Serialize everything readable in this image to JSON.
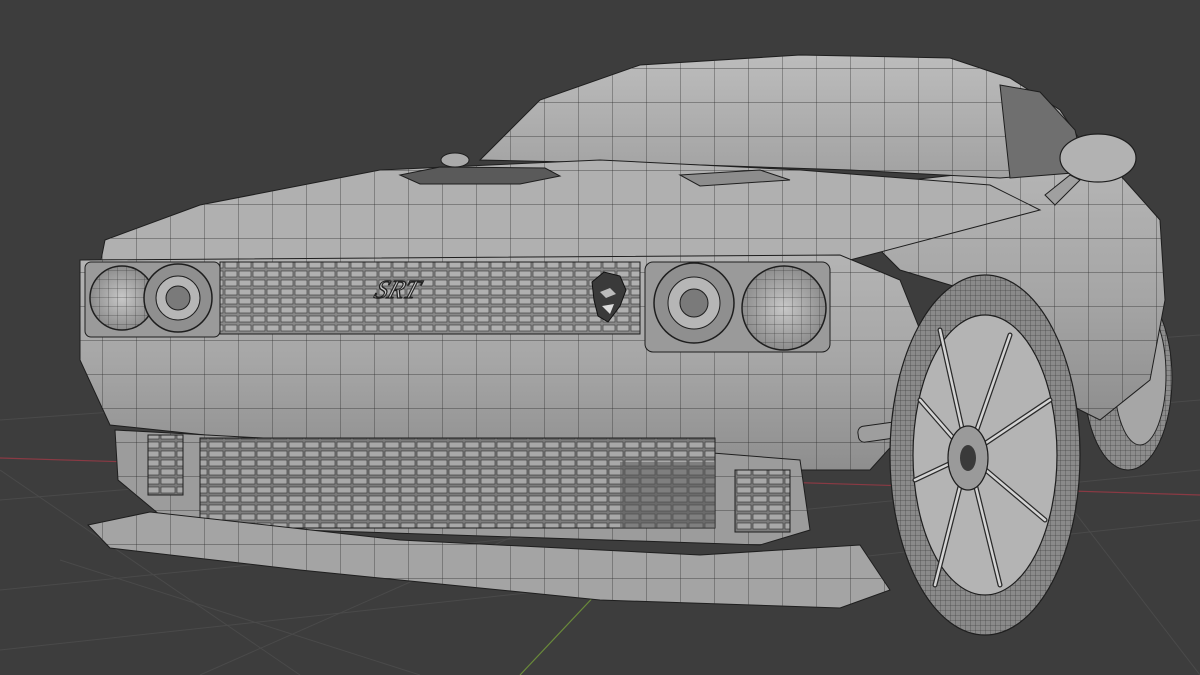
{
  "viewport": {
    "mode": "edit-mode-wireframe-overlay",
    "shading": "solid",
    "background_color": "#3d3d3d",
    "grid_line_color": "#4a4a4a",
    "x_axis_color": "#8a3a44",
    "y_axis_color": "#6a8a3a",
    "mesh_fill_color": "#a9a9a9",
    "mesh_edge_color": "#1e1e1e"
  },
  "model": {
    "badge_text": "SRT",
    "badge_emblem": "hellcat-head-icon"
  }
}
